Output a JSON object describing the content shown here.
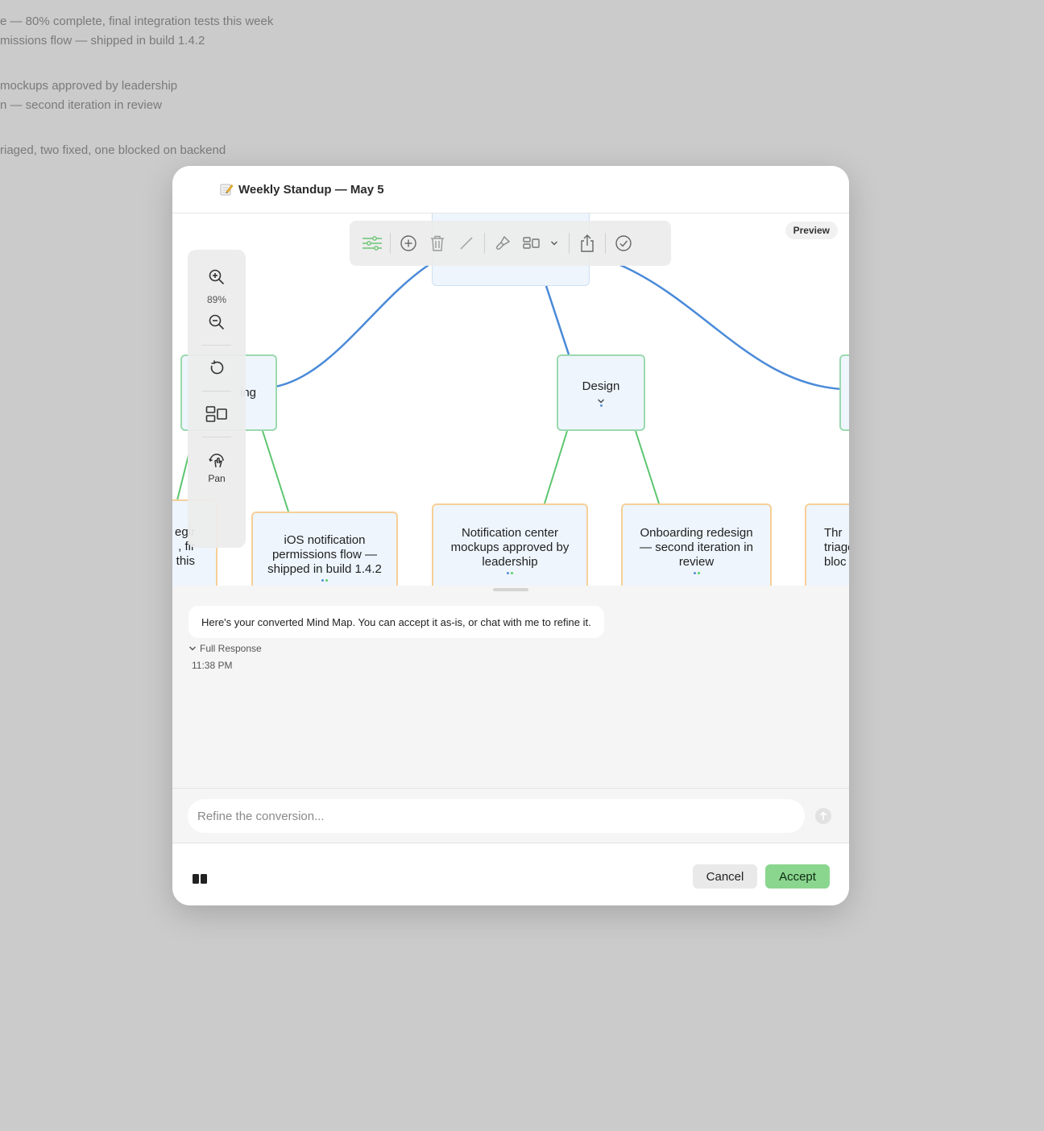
{
  "background_notes": [
    "e — 80% complete, final integration tests this week",
    "missions flow — shipped in build 1.4.2",
    "mockups approved by leadership",
    "n — second iteration in review",
    "riaged, two fixed, one blocked on backend"
  ],
  "window": {
    "title": "Weekly Standup — May 5",
    "title_icon": "memo-pencil-icon"
  },
  "canvas": {
    "preview_label": "Preview",
    "zoom_level": "89%",
    "pan_label": "Pan",
    "nodes": {
      "left_branch": "ing",
      "design": "Design",
      "leaf_partial_left": [
        "egir",
        ", fir",
        "this"
      ],
      "ios_notification": "iOS notification permissions flow — shipped in build 1.4.2",
      "notification_center": "Notification center mockups approved by leadership",
      "onboarding": "Onboarding redesign — second iteration in review",
      "leaf_partial_right": [
        "Thr",
        "triage",
        "bloc"
      ]
    },
    "colors": {
      "connector_blue": "#4a8ad8",
      "connector_green": "#5cc56e",
      "node_green_border": "#9bd9ae",
      "node_orange_border": "#f6cf97"
    }
  },
  "chat": {
    "message": "Here's your converted Mind Map. You can accept it as-is, or chat with me to refine it.",
    "full_response_label": "Full Response",
    "timestamp": "11:38 PM",
    "input_placeholder": "Refine the conversion..."
  },
  "footer": {
    "cancel_label": "Cancel",
    "accept_label": "Accept",
    "accent": "#8ad68f"
  }
}
